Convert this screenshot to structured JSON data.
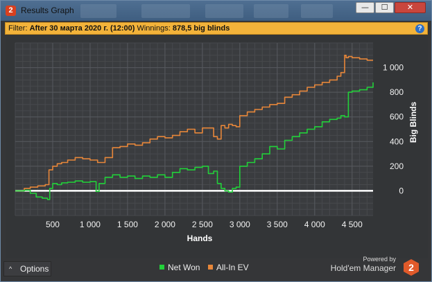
{
  "window": {
    "title": "Results Graph",
    "app_icon_glyph": "2",
    "buttons": {
      "minimize": "—",
      "maximize": "☐",
      "close": "✕"
    }
  },
  "filter": {
    "label": "Filter:",
    "value": "After 30 марта 2020 г. (12:00)",
    "winnings_label": "Winnings:",
    "winnings_value": "878,5 big blinds",
    "help_glyph": "?"
  },
  "legend": {
    "net_won": {
      "label": "Net Won",
      "color": "#22d13a"
    },
    "all_in_ev": {
      "label": "All-In EV",
      "color": "#e8873a"
    }
  },
  "options": {
    "label": "Options",
    "caret": "^"
  },
  "brand": {
    "powered_by": "Powered by",
    "name": "Hold'em Manager",
    "logo_glyph": "2"
  },
  "chart_data": {
    "type": "line",
    "xlabel": "Hands",
    "ylabel": "Big Blinds",
    "xlim": [
      0,
      4780
    ],
    "ylim": [
      -200,
      1200
    ],
    "x_ticks": [
      500,
      1000,
      1500,
      2000,
      2500,
      3000,
      3500,
      4000,
      4500
    ],
    "x_tick_labels": [
      "500",
      "1 000",
      "1 500",
      "2 000",
      "2 500",
      "3 000",
      "3 500",
      "4 000",
      "4 500"
    ],
    "y_ticks": [
      0,
      200,
      400,
      600,
      800,
      1000
    ],
    "y_tick_labels": [
      "0",
      "200",
      "400",
      "600",
      "800",
      "1 000"
    ],
    "grid": true,
    "zero_line_color": "#ffffff",
    "series": [
      {
        "name": "Net Won",
        "color": "#22d13a",
        "x": [
          0,
          120,
          200,
          280,
          360,
          430,
          460,
          500,
          560,
          620,
          700,
          800,
          900,
          1000,
          1080,
          1120,
          1200,
          1300,
          1400,
          1500,
          1600,
          1700,
          1800,
          1900,
          2000,
          2100,
          2200,
          2300,
          2400,
          2500,
          2580,
          2650,
          2700,
          2750,
          2800,
          2850,
          2900,
          2950,
          3000,
          3100,
          3200,
          3300,
          3400,
          3500,
          3600,
          3700,
          3800,
          3900,
          4000,
          4100,
          4200,
          4300,
          4350,
          4400,
          4450,
          4500,
          4600,
          4700,
          4780
        ],
        "y": [
          0,
          5,
          -20,
          -50,
          -60,
          -70,
          20,
          60,
          50,
          65,
          70,
          80,
          70,
          75,
          -5,
          60,
          110,
          130,
          110,
          120,
          100,
          120,
          110,
          130,
          110,
          150,
          180,
          170,
          190,
          200,
          140,
          160,
          60,
          20,
          0,
          -10,
          20,
          30,
          200,
          230,
          260,
          300,
          360,
          340,
          410,
          440,
          470,
          500,
          520,
          560,
          580,
          590,
          610,
          600,
          800,
          810,
          820,
          840,
          880
        ]
      },
      {
        "name": "All-In EV",
        "color": "#e8873a",
        "x": [
          0,
          120,
          200,
          300,
          400,
          450,
          500,
          560,
          620,
          700,
          800,
          900,
          1000,
          1100,
          1200,
          1300,
          1400,
          1500,
          1600,
          1700,
          1800,
          1900,
          2000,
          2100,
          2200,
          2300,
          2400,
          2500,
          2600,
          2650,
          2700,
          2750,
          2800,
          2850,
          2900,
          2950,
          3000,
          3100,
          3200,
          3300,
          3400,
          3500,
          3600,
          3700,
          3800,
          3900,
          4000,
          4100,
          4200,
          4300,
          4350,
          4400,
          4420,
          4450,
          4500,
          4600,
          4700,
          4780
        ],
        "y": [
          0,
          20,
          30,
          40,
          50,
          170,
          200,
          220,
          230,
          250,
          270,
          260,
          250,
          230,
          270,
          350,
          360,
          380,
          370,
          390,
          420,
          440,
          430,
          450,
          480,
          500,
          470,
          510,
          510,
          440,
          420,
          530,
          510,
          540,
          530,
          520,
          610,
          640,
          660,
          680,
          700,
          710,
          760,
          780,
          810,
          840,
          860,
          880,
          900,
          930,
          960,
          1100,
          1080,
          1090,
          1080,
          1070,
          1060,
          1060
        ]
      }
    ]
  }
}
